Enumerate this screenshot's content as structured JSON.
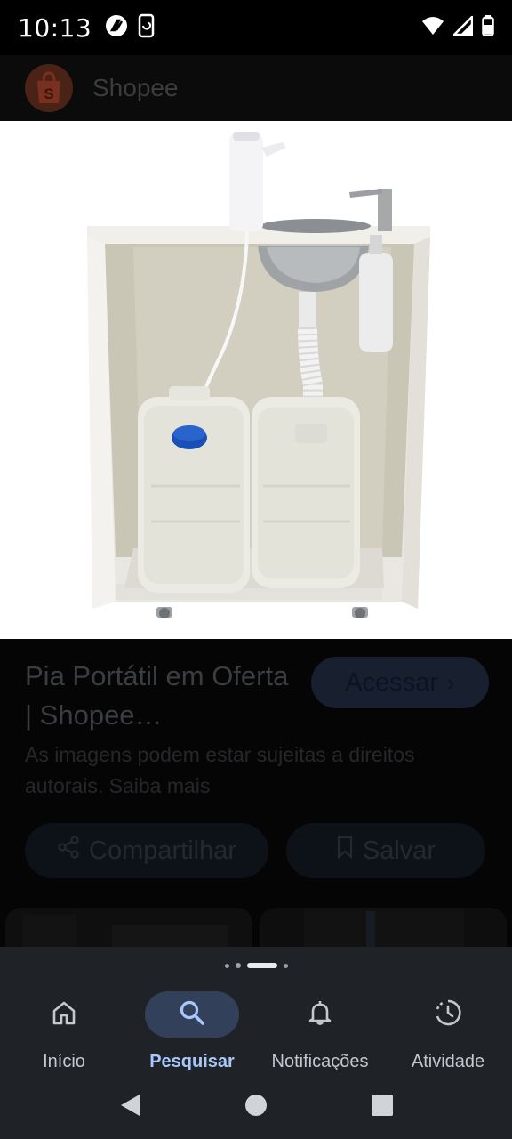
{
  "status_bar": {
    "time": "10:13",
    "icons": [
      "wifi-icon",
      "signal-icon",
      "battery-icon"
    ]
  },
  "source": {
    "name": "Shopee",
    "logo_letter": "S",
    "logo_color": "#ee4d2d"
  },
  "image": {
    "subject": "portable sink cabinet with two water jugs"
  },
  "result": {
    "title": "Pia Portátil em Oferta | Shopee…",
    "visit_label": "Acessar",
    "disclaimer": "As imagens podem estar sujeitas a direitos autorais. Saiba mais"
  },
  "actions": {
    "share_label": "Compartilhar",
    "save_label": "Salvar"
  },
  "pager": {
    "count": 4,
    "active_index": 2
  },
  "bottom_nav": {
    "items": [
      {
        "label": "Início",
        "icon": "home-icon",
        "active": false
      },
      {
        "label": "Pesquisar",
        "icon": "search-icon",
        "active": true
      },
      {
        "label": "Notificações",
        "icon": "bell-icon",
        "active": false
      },
      {
        "label": "Atividade",
        "icon": "activity-icon",
        "active": false
      }
    ]
  },
  "colors": {
    "active_nav": "#a8c7fa",
    "nav_background": "#1f2328"
  }
}
